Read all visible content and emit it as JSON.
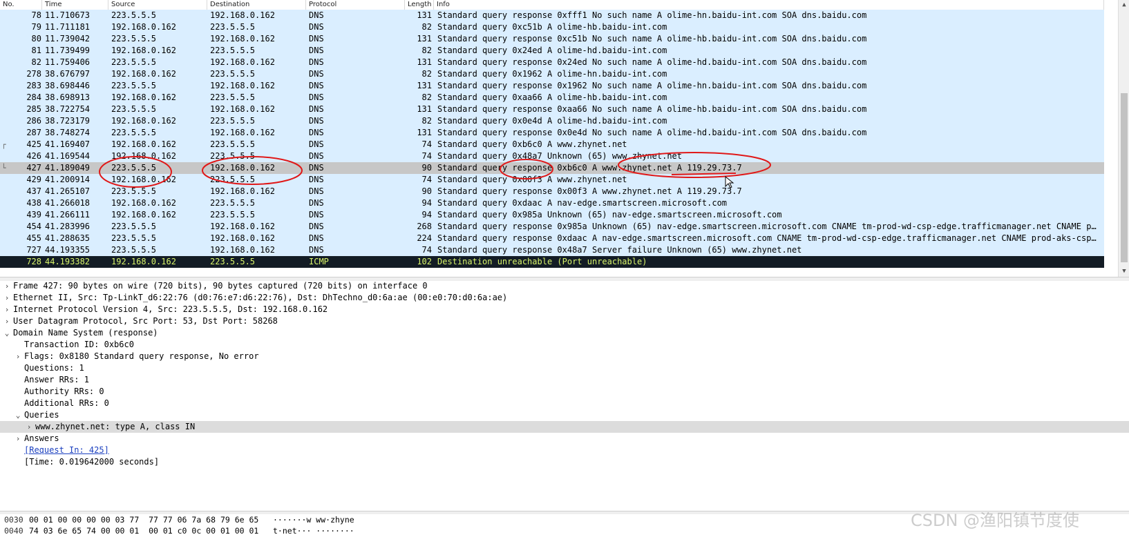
{
  "packet_list": {
    "columns": [
      "No.",
      "Time",
      "Source",
      "Destination",
      "Protocol",
      "Length",
      "Info"
    ],
    "rows": [
      {
        "no": "78",
        "time": "11.710673",
        "src": "223.5.5.5",
        "dst": "192.168.0.162",
        "proto": "DNS",
        "len": "131",
        "info": "Standard query response 0xfff1 No such name A olime-hn.baidu-int.com SOA dns.baidu.com"
      },
      {
        "no": "79",
        "time": "11.711181",
        "src": "192.168.0.162",
        "dst": "223.5.5.5",
        "proto": "DNS",
        "len": "82",
        "info": "Standard query 0xc51b A olime-hb.baidu-int.com"
      },
      {
        "no": "80",
        "time": "11.739042",
        "src": "223.5.5.5",
        "dst": "192.168.0.162",
        "proto": "DNS",
        "len": "131",
        "info": "Standard query response 0xc51b No such name A olime-hb.baidu-int.com SOA dns.baidu.com"
      },
      {
        "no": "81",
        "time": "11.739499",
        "src": "192.168.0.162",
        "dst": "223.5.5.5",
        "proto": "DNS",
        "len": "82",
        "info": "Standard query 0x24ed A olime-hd.baidu-int.com"
      },
      {
        "no": "82",
        "time": "11.759406",
        "src": "223.5.5.5",
        "dst": "192.168.0.162",
        "proto": "DNS",
        "len": "131",
        "info": "Standard query response 0x24ed No such name A olime-hd.baidu-int.com SOA dns.baidu.com"
      },
      {
        "no": "278",
        "time": "38.676797",
        "src": "192.168.0.162",
        "dst": "223.5.5.5",
        "proto": "DNS",
        "len": "82",
        "info": "Standard query 0x1962 A olime-hn.baidu-int.com"
      },
      {
        "no": "283",
        "time": "38.698446",
        "src": "223.5.5.5",
        "dst": "192.168.0.162",
        "proto": "DNS",
        "len": "131",
        "info": "Standard query response 0x1962 No such name A olime-hn.baidu-int.com SOA dns.baidu.com"
      },
      {
        "no": "284",
        "time": "38.698913",
        "src": "192.168.0.162",
        "dst": "223.5.5.5",
        "proto": "DNS",
        "len": "82",
        "info": "Standard query 0xaa66 A olime-hb.baidu-int.com"
      },
      {
        "no": "285",
        "time": "38.722754",
        "src": "223.5.5.5",
        "dst": "192.168.0.162",
        "proto": "DNS",
        "len": "131",
        "info": "Standard query response 0xaa66 No such name A olime-hb.baidu-int.com SOA dns.baidu.com"
      },
      {
        "no": "286",
        "time": "38.723179",
        "src": "192.168.0.162",
        "dst": "223.5.5.5",
        "proto": "DNS",
        "len": "82",
        "info": "Standard query 0x0e4d A olime-hd.baidu-int.com"
      },
      {
        "no": "287",
        "time": "38.748274",
        "src": "223.5.5.5",
        "dst": "192.168.0.162",
        "proto": "DNS",
        "len": "131",
        "info": "Standard query response 0x0e4d No such name A olime-hd.baidu-int.com SOA dns.baidu.com"
      },
      {
        "no": "425",
        "time": "41.169407",
        "src": "192.168.0.162",
        "dst": "223.5.5.5",
        "proto": "DNS",
        "len": "74",
        "info": "Standard query 0xb6c0 A www.zhynet.net",
        "rel": "┌"
      },
      {
        "no": "426",
        "time": "41.169544",
        "src": "192.168.0.162",
        "dst": "223.5.5.5",
        "proto": "DNS",
        "len": "74",
        "info": "Standard query 0x48a7 Unknown (65) www.zhynet.net"
      },
      {
        "no": "427",
        "time": "41.189049",
        "src": "223.5.5.5",
        "dst": "192.168.0.162",
        "proto": "DNS",
        "len": "90",
        "info": "Standard query response 0xb6c0 A www.zhynet.net A 119.29.73.7",
        "rel": "└",
        "state": "sel-soft"
      },
      {
        "no": "429",
        "time": "41.200914",
        "src": "192.168.0.162",
        "dst": "223.5.5.5",
        "proto": "DNS",
        "len": "74",
        "info": "Standard query 0x00f3 A www.zhynet.net"
      },
      {
        "no": "437",
        "time": "41.265107",
        "src": "223.5.5.5",
        "dst": "192.168.0.162",
        "proto": "DNS",
        "len": "90",
        "info": "Standard query response 0x00f3 A www.zhynet.net A 119.29.73.7"
      },
      {
        "no": "438",
        "time": "41.266018",
        "src": "192.168.0.162",
        "dst": "223.5.5.5",
        "proto": "DNS",
        "len": "94",
        "info": "Standard query 0xdaac A nav-edge.smartscreen.microsoft.com"
      },
      {
        "no": "439",
        "time": "41.266111",
        "src": "192.168.0.162",
        "dst": "223.5.5.5",
        "proto": "DNS",
        "len": "94",
        "info": "Standard query 0x985a Unknown (65) nav-edge.smartscreen.microsoft.com"
      },
      {
        "no": "454",
        "time": "41.283996",
        "src": "223.5.5.5",
        "dst": "192.168.0.162",
        "proto": "DNS",
        "len": "268",
        "info": "Standard query response 0x985a Unknown (65) nav-edge.smartscreen.microsoft.com CNAME tm-prod-wd-csp-edge.trafficmanager.net CNAME prod-aks-…"
      },
      {
        "no": "455",
        "time": "41.288635",
        "src": "223.5.5.5",
        "dst": "192.168.0.162",
        "proto": "DNS",
        "len": "224",
        "info": "Standard query response 0xdaac A nav-edge.smartscreen.microsoft.com CNAME tm-prod-wd-csp-edge.trafficmanager.net CNAME prod-aks-csp-1-dns.s…"
      },
      {
        "no": "727",
        "time": "44.193355",
        "src": "223.5.5.5",
        "dst": "192.168.0.162",
        "proto": "DNS",
        "len": "74",
        "info": "Standard query response 0x48a7 Server failure Unknown (65) www.zhynet.net"
      },
      {
        "no": "728",
        "time": "44.193382",
        "src": "192.168.0.162",
        "dst": "223.5.5.5",
        "proto": "ICMP",
        "len": "102",
        "info": "Destination unreachable (Port unreachable)",
        "state": "sel-dark"
      }
    ]
  },
  "details": [
    {
      "arrow": "›",
      "indent": 0,
      "text": "Frame 427: 90 bytes on wire (720 bits), 90 bytes captured (720 bits) on interface 0"
    },
    {
      "arrow": "›",
      "indent": 0,
      "text": "Ethernet II, Src: Tp-LinkT_d6:22:76 (d0:76:e7:d6:22:76), Dst: DhTechno_d0:6a:ae (00:e0:70:d0:6a:ae)"
    },
    {
      "arrow": "›",
      "indent": 0,
      "text": "Internet Protocol Version 4, Src: 223.5.5.5, Dst: 192.168.0.162"
    },
    {
      "arrow": "›",
      "indent": 0,
      "text": "User Datagram Protocol, Src Port: 53, Dst Port: 58268"
    },
    {
      "arrow": "⌄",
      "indent": 0,
      "text": "Domain Name System (response)"
    },
    {
      "arrow": "",
      "indent": 1,
      "text": "Transaction ID: 0xb6c0"
    },
    {
      "arrow": "›",
      "indent": 1,
      "text": "Flags: 0x8180 Standard query response, No error"
    },
    {
      "arrow": "",
      "indent": 1,
      "text": "Questions: 1"
    },
    {
      "arrow": "",
      "indent": 1,
      "text": "Answer RRs: 1"
    },
    {
      "arrow": "",
      "indent": 1,
      "text": "Authority RRs: 0"
    },
    {
      "arrow": "",
      "indent": 1,
      "text": "Additional RRs: 0"
    },
    {
      "arrow": "⌄",
      "indent": 1,
      "text": "Queries"
    },
    {
      "arrow": "›",
      "indent": 2,
      "text": "www.zhynet.net: type A, class IN",
      "hl": true
    },
    {
      "arrow": "›",
      "indent": 1,
      "text": "Answers"
    },
    {
      "arrow": "",
      "indent": 1,
      "text": "[Request In: 425]",
      "link": true
    },
    {
      "arrow": "",
      "indent": 1,
      "text": "[Time: 0.019642000 seconds]"
    }
  ],
  "bytes": [
    {
      "offset": "0030",
      "hex": "00 01 00 00 00 00 03 77  77 77 06 7a 68 79 6e 65",
      "ascii": "·······w ww·zhyne"
    },
    {
      "offset": "0040",
      "hex": "74 03 6e 65 74 00 00 01  00 01 c0 0c 00 01 00 01",
      "ascii": "t·net··· ········"
    }
  ],
  "watermark": "CSDN @渔阳镇节度使",
  "colors": {
    "row_bg": "#daeeff",
    "selected_dark": "#131c25",
    "selected_text": "#d8f46a",
    "annotation": "#e01818"
  }
}
